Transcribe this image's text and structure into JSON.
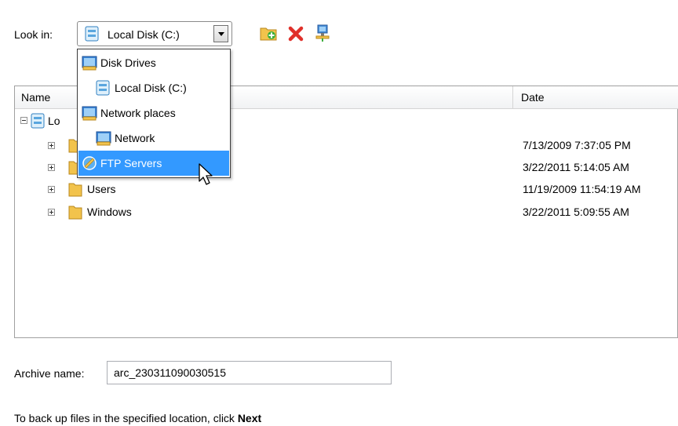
{
  "look_in": {
    "label": "Look in:",
    "value": "Local Disk (C:)"
  },
  "toolbar": {
    "icons": [
      "new-folder-icon",
      "delete-icon",
      "network-connect-icon"
    ]
  },
  "dropdown": {
    "items": [
      {
        "label": "Disk Drives",
        "icon": "disk-drives-icon",
        "level": 0
      },
      {
        "label": "Local Disk (C:)",
        "icon": "drive-icon",
        "level": 1
      },
      {
        "label": "Network places",
        "icon": "network-places-icon",
        "level": 0
      },
      {
        "label": "Network",
        "icon": "network-icon",
        "level": 1
      },
      {
        "label": "FTP Servers",
        "icon": "ftp-icon",
        "level": 0,
        "selected": true
      }
    ]
  },
  "file_list": {
    "columns": [
      "Name",
      "Date"
    ],
    "root": {
      "label": "Lo"
    },
    "rows": [
      {
        "name": "",
        "date": "7/13/2009 7:37:05 PM"
      },
      {
        "name": "",
        "date": "3/22/2011 5:14:05 AM"
      },
      {
        "name": "Users",
        "date": "11/19/2009 11:54:19 AM"
      },
      {
        "name": "Windows",
        "date": "3/22/2011 5:09:55 AM"
      }
    ]
  },
  "archive": {
    "label": "Archive name:",
    "value": "arc_230311090030515"
  },
  "hint": {
    "text": "To back up files in the specified location, click ",
    "bold": "Next"
  },
  "colors": {
    "selection": "#3399ff",
    "folder": "#f2c34c",
    "delete": "#e0302a"
  }
}
